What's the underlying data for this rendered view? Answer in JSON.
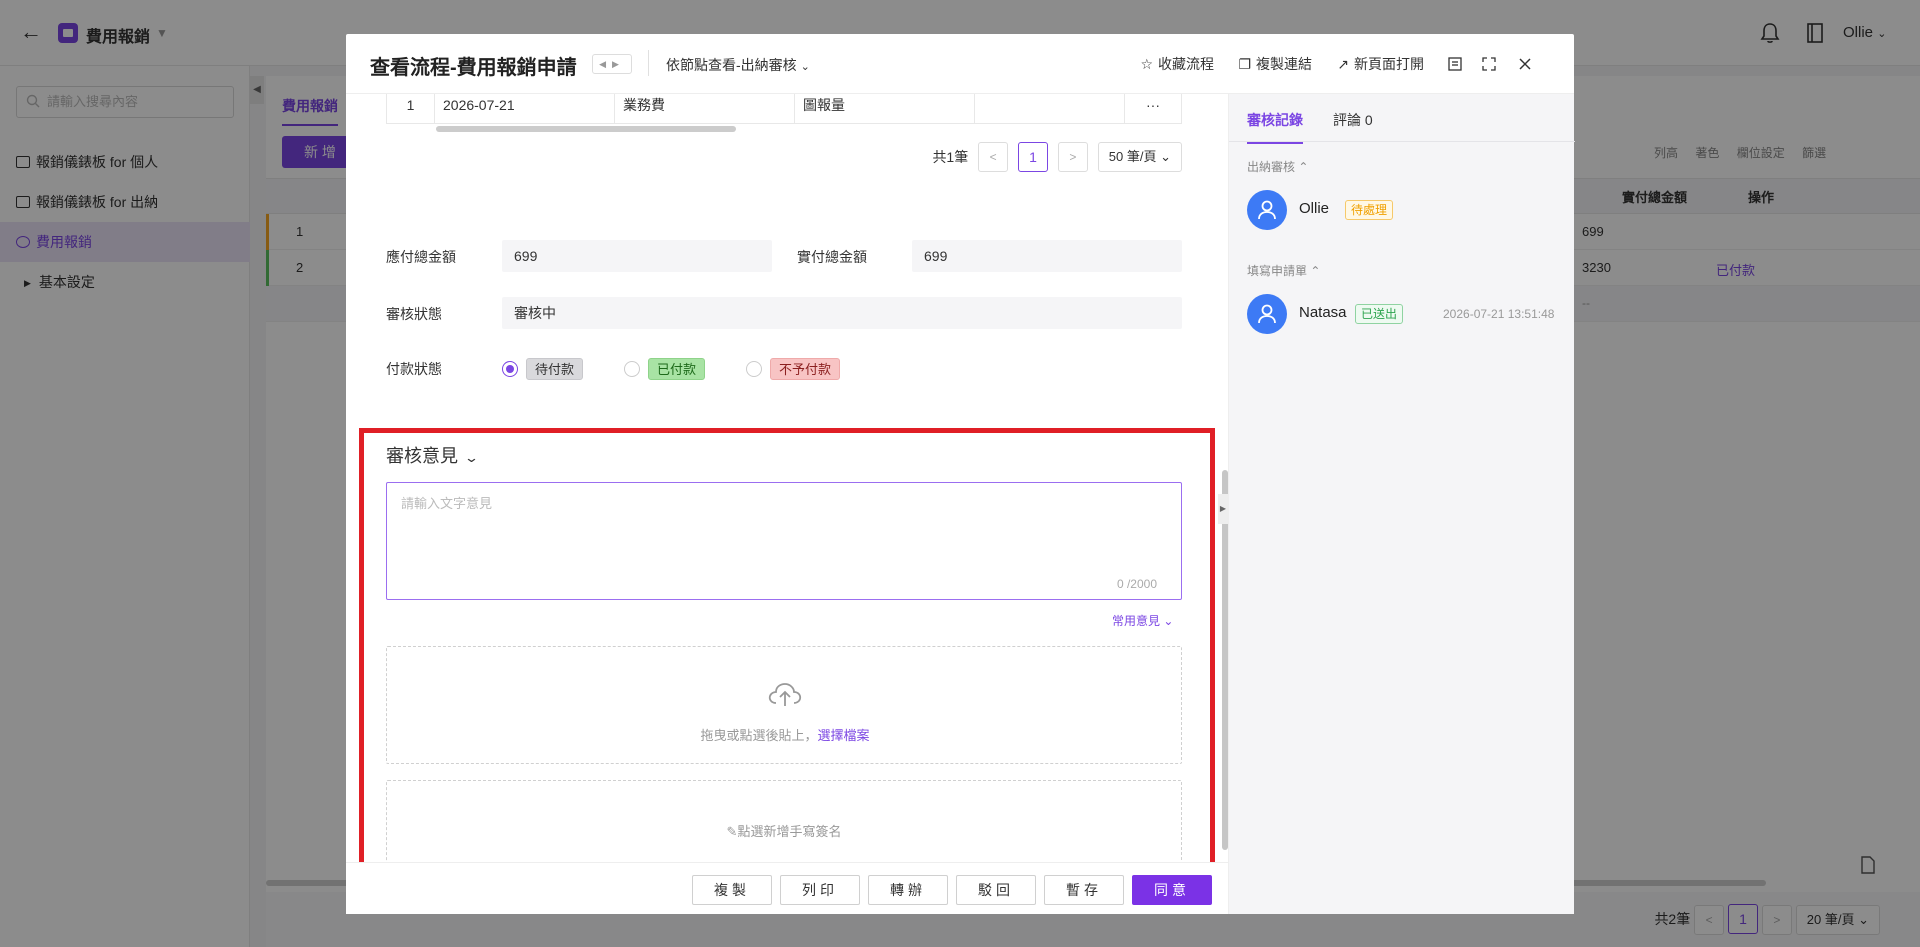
{
  "app": {
    "title": "費用報銷",
    "user": "Ollie"
  },
  "sidebar": {
    "search_placeholder": "請輸入搜尋內容",
    "items": [
      {
        "label": "報銷儀錶板 for 個人"
      },
      {
        "label": "報銷儀錶板 for 出納"
      },
      {
        "label": "費用報銷"
      },
      {
        "label": "基本設定"
      }
    ]
  },
  "background": {
    "tab": "費用報銷",
    "new_button": "新 增",
    "tools": [
      "列高",
      "著色",
      "欄位設定",
      "篩選"
    ],
    "headers": {
      "amount": "實付總金額",
      "op": "操作"
    },
    "rows": [
      {
        "num": "1",
        "amount": "699",
        "op": ""
      },
      {
        "num": "2",
        "amount": "3230",
        "op": "已付款"
      }
    ],
    "row3_value": "--",
    "pager": {
      "total": "共2筆",
      "page": "1",
      "size": "20 筆/頁"
    }
  },
  "modal": {
    "title": "查看流程-費用報銷申請",
    "node_view": "依節點查看-出納審核",
    "actions": {
      "favorite": "收藏流程",
      "copy_link": "複製連結",
      "open_new": "新頁面打開"
    },
    "inner_table": {
      "row_num": "1",
      "date": "2026-07-21",
      "category": "業務費",
      "item": "圖報量",
      "more": "···"
    },
    "pager": {
      "total": "共1筆",
      "page": "1",
      "size": "50 筆/頁"
    },
    "fields": {
      "payable_label": "應付總金額",
      "payable_value": "699",
      "paid_label": "實付總金額",
      "paid_value": "699",
      "status_label": "審核狀態",
      "status_value": "審核中",
      "payment_label": "付款狀態",
      "payment_options": [
        "待付款",
        "已付款",
        "不予付款"
      ]
    },
    "review": {
      "title": "審核意見",
      "placeholder": "請輸入文字意見",
      "counter": "0 /2000",
      "common": "常用意見",
      "upload_text": "拖曳或點選後貼上，",
      "upload_link": "選擇檔案",
      "signature": "點選新增手寫簽名"
    },
    "footer": {
      "copy": "複製",
      "print": "列印",
      "transfer": "轉辦",
      "reject": "駁回",
      "save": "暫存",
      "approve": "同意"
    },
    "right_panel": {
      "tab_records": "審核記錄",
      "tab_comments": "評論 0",
      "group1": "出納審核",
      "person1": {
        "name": "Ollie",
        "badge": "待處理"
      },
      "group2": "填寫申請單",
      "person2": {
        "name": "Natasa",
        "badge": "已送出",
        "time": "2026-07-21 13:51:48"
      }
    }
  },
  "colors": {
    "accent": "#7b46e3",
    "highlight": "#e01f26",
    "avatar": "#3d7af5"
  }
}
